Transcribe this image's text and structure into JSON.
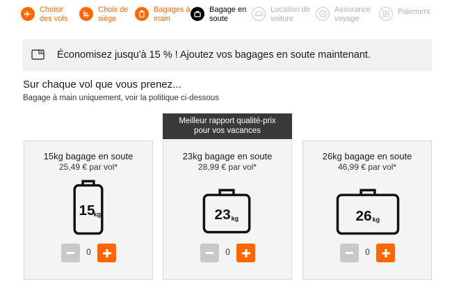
{
  "steps": [
    {
      "label": "Choisir\ndes vols",
      "state": "done",
      "icon": "plane-icon"
    },
    {
      "label": "Choix de\nsiège",
      "state": "done",
      "icon": "seat-icon"
    },
    {
      "label": "Bagages à\nmain",
      "state": "done",
      "icon": "cabin-bag-icon"
    },
    {
      "label": "Bagage en\nsoute",
      "state": "active",
      "icon": "hold-luggage-icon"
    },
    {
      "label": "Location de\nvoiture",
      "state": "todo",
      "icon": "car-icon"
    },
    {
      "label": "Assurance\nvoyage",
      "state": "todo",
      "icon": "shield-icon"
    },
    {
      "label": "Paiement",
      "state": "todo",
      "icon": "payment-icon"
    }
  ],
  "promo": {
    "text": "Économisez jusqu'à 15 % ! Ajoutez vos bagages en soute maintenant.",
    "icon": "price-tag-icon"
  },
  "heading": "Sur chaque vol que vous prenez...",
  "subheading": "Bagage à main uniquement, voir la politique ci-dessous",
  "best_value": "Meilleur rapport qualité-prix\npour vos vacances",
  "options": [
    {
      "title": "15kg bagage en soute",
      "price": "25,49 € par vol*",
      "weight": "15",
      "unit": "kg",
      "qty": "0"
    },
    {
      "title": "23kg bagage en soute",
      "price": "28,99 € par vol*",
      "weight": "23",
      "unit": "kg",
      "qty": "0"
    },
    {
      "title": "26kg bagage en soute",
      "price": "46,99 € par vol*",
      "weight": "26",
      "unit": "kg",
      "qty": "0"
    }
  ],
  "colors": {
    "accent": "#ff6600",
    "active": "#000000",
    "inactive": "#c8c8c8",
    "disabled_button": "#c9c9c9"
  }
}
